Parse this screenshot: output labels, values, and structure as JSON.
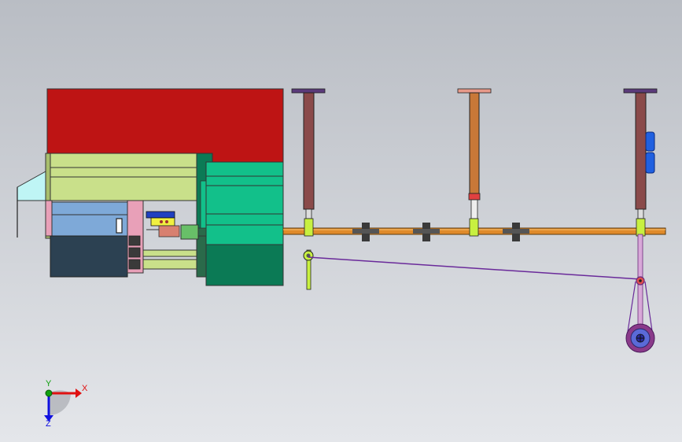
{
  "viewport": {
    "background_top": "#b9bdc4",
    "background_bottom": "#e4e6ea"
  },
  "colors": {
    "housing_red": "#be1414",
    "olive_panel": "#c9e08a",
    "olive_dark": "#a8be6c",
    "teal_block": "#12c08a",
    "teal_dark": "#0b7a55",
    "blue_panel": "#7ea9d8",
    "navy_block": "#2c4152",
    "pink_panel": "#e8a0b8",
    "cyan_wedge": "#bff5f5",
    "rail_orange": "#e08a2a",
    "rod_brown": "#8a4a4a",
    "rod_copper": "#c87838",
    "cap_purple": "#5a3a7a",
    "cap_salmon": "#e89a8a",
    "collar_green": "#c8f040",
    "wheel_purple": "#8a3a8a",
    "wheel_blue": "#5a6ad8",
    "link_purple": "#6a2a9a",
    "hinge_blue": "#2060e0",
    "clamp_dark": "#3a3a3a"
  },
  "axis_triad": {
    "x_label": "X",
    "y_label": "Y",
    "z_label": "Z",
    "x_color": "#e01010",
    "y_color": "#10a010",
    "z_color": "#1010e0"
  },
  "components": [
    "main-housing",
    "feed-mechanism",
    "guide-rail",
    "vertical-rod-left",
    "vertical-rod-center",
    "vertical-rod-right",
    "rail-clamp",
    "linkage-wire",
    "drive-wheel"
  ]
}
